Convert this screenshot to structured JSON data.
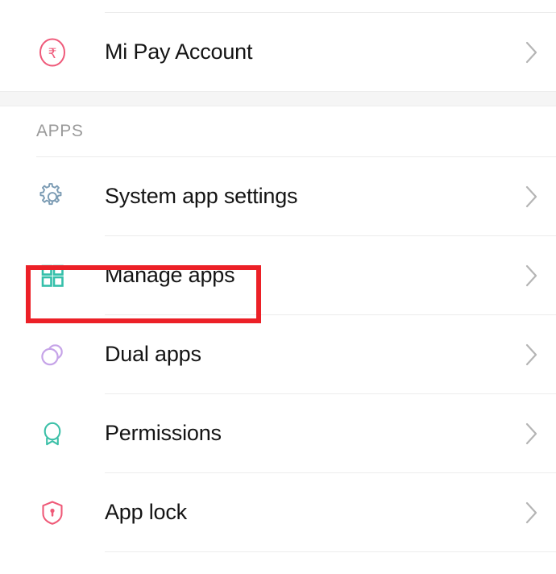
{
  "screen": {
    "background": "#ffffff",
    "highlight_color": "#ec2027"
  },
  "top_section": {
    "items": [
      {
        "label": "Mi Pay Account",
        "icon": "rupee-circle-icon",
        "icon_color": "#ef5a7a",
        "chevron": "›"
      }
    ]
  },
  "apps_section": {
    "header": "APPS",
    "items": [
      {
        "label": "System app settings",
        "icon": "gear-icon",
        "icon_color": "#7c9cb4",
        "chevron": "›",
        "highlighted": false
      },
      {
        "label": "Manage apps",
        "icon": "grid-apps-icon",
        "icon_color": "#35bfaa",
        "chevron": "›",
        "highlighted": true
      },
      {
        "label": "Dual apps",
        "icon": "dual-circles-icon",
        "icon_color": "#c6a4e8",
        "chevron": "›",
        "highlighted": false
      },
      {
        "label": "Permissions",
        "icon": "award-badge-icon",
        "icon_color": "#3cc0a8",
        "chevron": "›",
        "highlighted": false
      },
      {
        "label": "App lock",
        "icon": "shield-lock-icon",
        "icon_color": "#ef5a78",
        "chevron": "›",
        "highlighted": false
      }
    ]
  }
}
